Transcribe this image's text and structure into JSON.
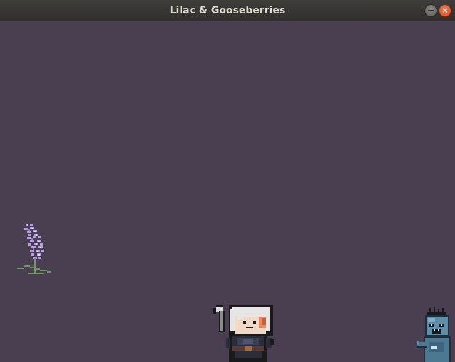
{
  "window": {
    "title": "Lilac & Gooseberries",
    "close_glyph": "×"
  },
  "icons": {
    "minimize": "minimize-icon",
    "close": "close-icon"
  },
  "colors": {
    "background": "#4a3f50",
    "titlebar": "#3a3936",
    "close_button": "#e8613a",
    "lilac": "#b79be3",
    "stem": "#6f9a5e",
    "player_armor": "#2b2d3a",
    "player_hair": "#e6e6e6",
    "zombie": "#5f8ea8"
  },
  "entities": {
    "lilac": "lilac-flower",
    "player": "player-character",
    "enemy": "blue-zombie"
  }
}
